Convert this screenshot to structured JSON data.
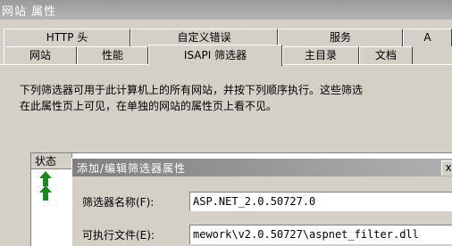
{
  "window": {
    "title": "网站 属性"
  },
  "tabs_back": [
    "HTTP 头",
    "自定义错误",
    "服务",
    "A"
  ],
  "tabs_front": [
    "网站",
    "性能",
    "ISAPI 筛选器",
    "主目录",
    "文档"
  ],
  "description": {
    "line1": "下列筛选器可用于此计算机上的所有网站，并按下列顺序执行。这些筛选",
    "line2": "在此属性页上可见，在单独的网站的属性页上看不见。"
  },
  "filter_list": {
    "status_header": "状态"
  },
  "dialog": {
    "title": "添加/编辑筛选器属性",
    "close_glyph": "x",
    "name_label": "筛选器名称(F):",
    "name_value": "ASP.NET_2.0.50727.0",
    "exe_label": "可执行文件(E):",
    "exe_value": "mework\\v2.0.50727\\aspnet_filter.dll"
  }
}
